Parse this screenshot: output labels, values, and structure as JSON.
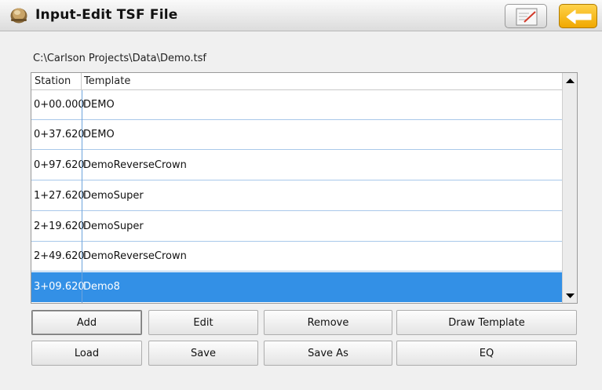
{
  "window": {
    "title": "Input-Edit TSF File"
  },
  "toolbar": {
    "notes_icon": "notepad-edit-icon",
    "back_icon": "back-arrow-icon",
    "back_color": "#f5b400"
  },
  "file": {
    "path": "C:\\Carlson Projects\\Data\\Demo.tsf"
  },
  "grid": {
    "columns": [
      "Station",
      "Template"
    ],
    "rows": [
      {
        "station": "0+00.000",
        "template": "DEMO"
      },
      {
        "station": "0+37.620",
        "template": "DEMO"
      },
      {
        "station": "0+97.620",
        "template": "DemoReverseCrown"
      },
      {
        "station": "1+27.620",
        "template": "DemoSuper"
      },
      {
        "station": "2+19.620",
        "template": "DemoSuper"
      },
      {
        "station": "2+49.620",
        "template": "DemoReverseCrown"
      },
      {
        "station": "3+09.620",
        "template": "Demo8",
        "selected": true
      }
    ],
    "selection_color": "#3390e6"
  },
  "buttons": {
    "add": "Add",
    "edit": "Edit",
    "remove": "Remove",
    "draw_template": "Draw Template",
    "load": "Load",
    "save": "Save",
    "save_as": "Save As",
    "eq": "EQ"
  }
}
